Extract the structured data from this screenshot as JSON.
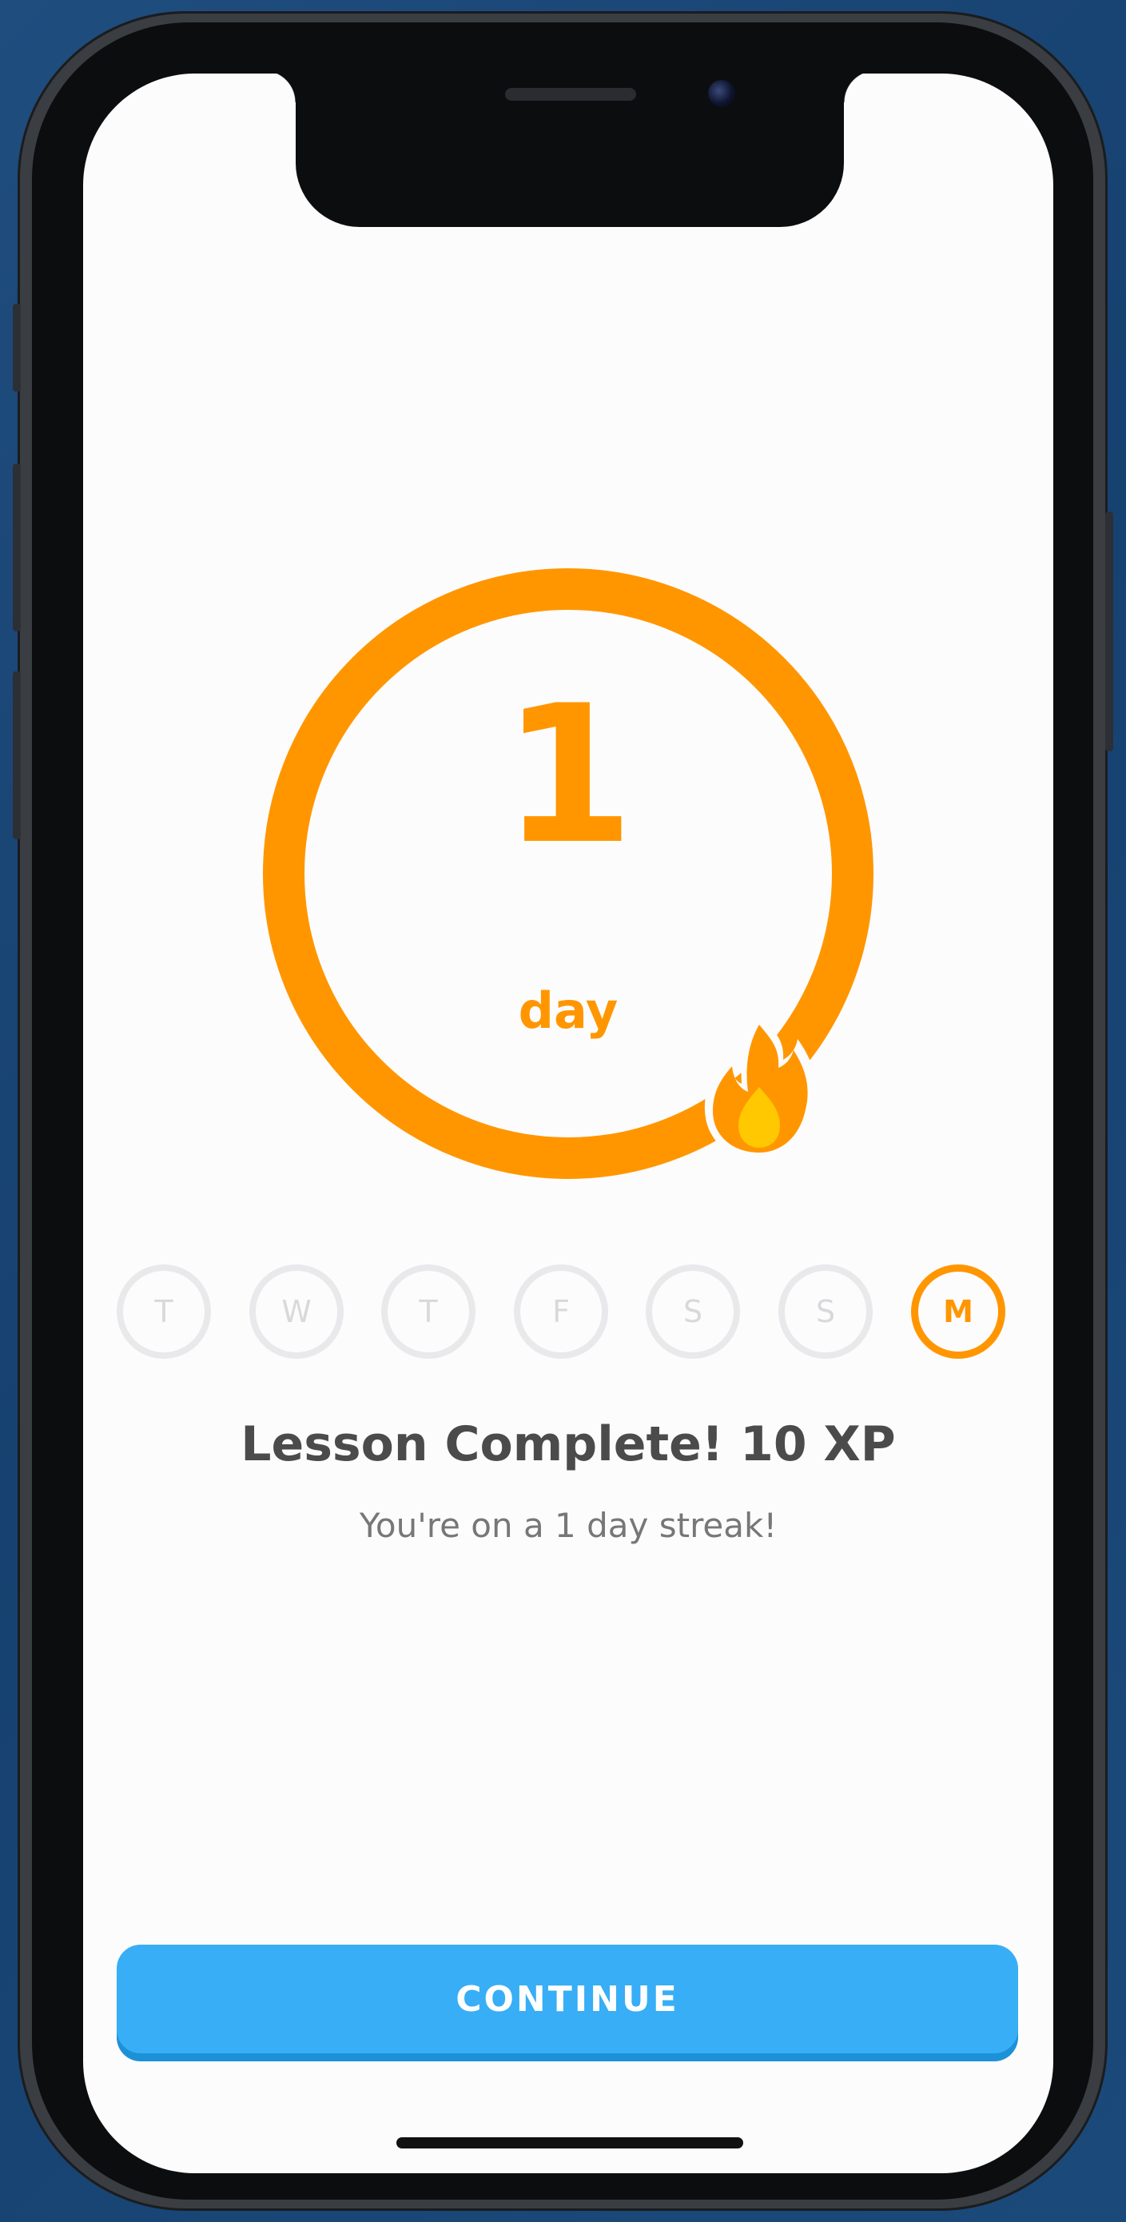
{
  "streak": {
    "count": "1",
    "unit": "day",
    "color": "#ff9600",
    "flame_icon": "flame-icon"
  },
  "week": {
    "days": [
      {
        "label": "T",
        "active": false
      },
      {
        "label": "W",
        "active": false
      },
      {
        "label": "T",
        "active": false
      },
      {
        "label": "F",
        "active": false
      },
      {
        "label": "S",
        "active": false
      },
      {
        "label": "S",
        "active": false
      },
      {
        "label": "M",
        "active": true
      }
    ]
  },
  "result": {
    "title": "Lesson Complete! 10 XP",
    "subtitle": "You're on a 1 day streak!"
  },
  "actions": {
    "continue_label": "CONTINUE",
    "continue_color": "#37aef5"
  }
}
